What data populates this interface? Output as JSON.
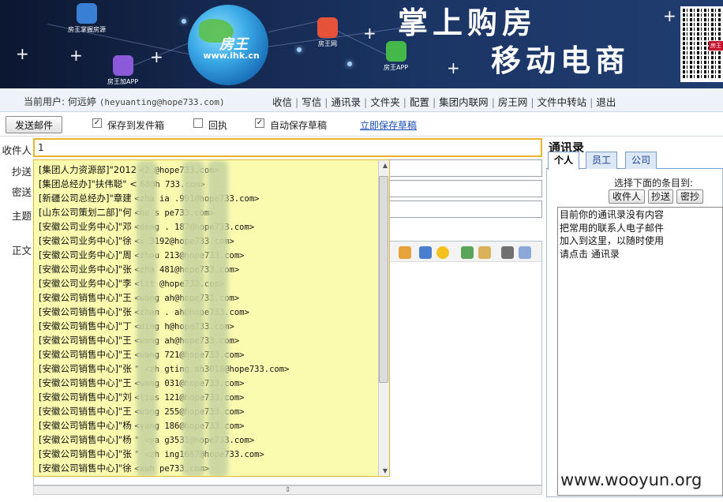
{
  "banner": {
    "globe_text": "房王",
    "globe_sub": "www.ihk.cn",
    "slogan_line1": "掌上购房",
    "slogan_line2": "移动电商",
    "app_badges": [
      "房王掌握房源",
      "房王网",
      "房王APP",
      "房王加APP"
    ],
    "qr_tag": "房王"
  },
  "nav": {
    "user_label": "当前用户:",
    "user_name": "何远婷",
    "user_email": "(heyuanting@hope733.com)",
    "links": [
      "收信",
      "写信",
      "通讯录",
      "文件夹",
      "配置",
      "集团内联网",
      "房王网",
      "文件中转站",
      "退出"
    ]
  },
  "toolbar": {
    "send_label": "发送邮件",
    "save_sent_label": "保存到发件箱",
    "receipt_label": "回执",
    "autosave_label": "自动保存草稿",
    "save_now_label": "立即保存草稿",
    "check_mark": "✓"
  },
  "form": {
    "to_label": "收件人",
    "cc_label": "抄送",
    "bcc_label": "密送",
    "subject_label": "主题",
    "body_label": "正文",
    "to_value": "1"
  },
  "suggestions": [
    {
      "dept": "[集团人力资源部]\"2012",
      "email": "<2         @hope733.com>"
    },
    {
      "dept": "[集团总经办]\"扶伟聪\" <",
      "email": "68@h     733.com>"
    },
    {
      "dept": "[新疆公司总经办]\"章建",
      "email": "<zha    ia     .991@hope733.com>"
    },
    {
      "dept": "[山东公司策划二部]\"何",
      "email": "<he     s     pe733.com>"
    },
    {
      "dept": "[安徽公司业务中心]\"邓",
      "email": "<deng    .  187@hope733.com>"
    },
    {
      "dept": "[安徽公司业务中心]\"徐",
      "email": "<x     3192@hope733.com>"
    },
    {
      "dept": "[安徽公司业务中心]\"周",
      "email": "<zhou     213@hope733.com>"
    },
    {
      "dept": "[安徽公司业务中心]\"张",
      "email": "<zha     481@hope733.com>"
    },
    {
      "dept": "[安徽公司业务中心]\"李",
      "email": "<lit      @hope733.com>"
    },
    {
      "dept": "[安徽公司销售中心]\"王",
      "email": "<wang     ah@hope733.com>"
    },
    {
      "dept": "[安徽公司销售中心]\"张",
      "email": "<zhan     . ah@hope733.com>"
    },
    {
      "dept": "[安徽公司销售中心]\"丁",
      "email": "<ding     h@hope733.com>"
    },
    {
      "dept": "[安徽公司销售中心]\"王",
      "email": "<wang     ah@hope733.com>"
    },
    {
      "dept": "[安徽公司销售中心]\"王",
      "email": "<wang     721@hope733.com>"
    },
    {
      "dept": "[安徽公司销售中心]\"张",
      "email": "\" <zh    gting.ah3018@hope733.com>"
    },
    {
      "dept": "[安徽公司销售中心]\"王",
      "email": "<wang    031@hope733.com>"
    },
    {
      "dept": "[安徽公司销售中心]\"刘",
      "email": "<lius     121@hope733.com>"
    },
    {
      "dept": "[安徽公司销售中心]\"王",
      "email": "<wang     255@hope733.com>"
    },
    {
      "dept": "[安徽公司销售中心]\"杨",
      "email": "<yang    186@hope733.com>"
    },
    {
      "dept": "[安徽公司销售中心]\"杨",
      "email": "\" <ya     g3531@hope733.com>"
    },
    {
      "dept": "[安徽公司销售中心]\"张",
      "email": "\" <zh    ing1667@hope733.com>"
    },
    {
      "dept": "[安徽公司销售中心]\"徐",
      "email": "<xuh     pe733.com>"
    }
  ],
  "contacts": {
    "title": "通讯录",
    "tabs": [
      "个人",
      "员工",
      "公司"
    ],
    "select_hint": "选择下面的条目到:",
    "to_btn": "收件人",
    "cc_btn": "抄送",
    "bcc_btn": "密抄",
    "empty_lines": [
      "目前你的通讯录没有内容",
      "把常用的联系人电子邮件",
      "加入到这里，以随时使用",
      "请点击 通讯录"
    ]
  },
  "editor_resize_icon": "⇕",
  "watermark": "www.wooyun.org"
}
